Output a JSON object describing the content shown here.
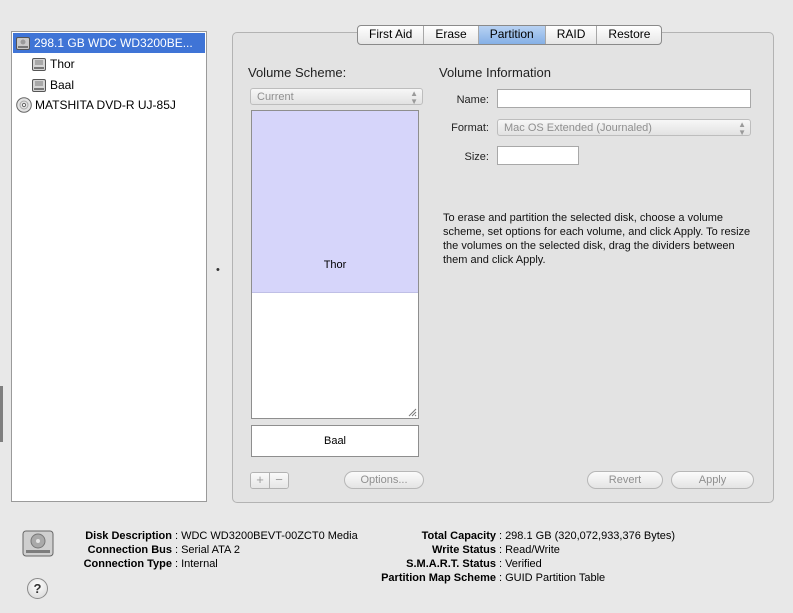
{
  "sidebar": {
    "items": [
      {
        "label": "298.1 GB WDC WD3200BE...",
        "icon": "hard-disk-icon",
        "selected": true
      },
      {
        "label": "Thor",
        "icon": "volume-icon"
      },
      {
        "label": "Baal",
        "icon": "volume-icon"
      },
      {
        "label": "MATSHITA DVD-R UJ-85J",
        "icon": "optical-disc-icon"
      }
    ]
  },
  "tabs": [
    {
      "label": "First Aid"
    },
    {
      "label": "Erase"
    },
    {
      "label": "Partition",
      "active": true
    },
    {
      "label": "RAID"
    },
    {
      "label": "Restore"
    }
  ],
  "volume_scheme": {
    "title": "Volume Scheme:",
    "selected": "Current",
    "partitions": [
      "Thor",
      "Baal"
    ]
  },
  "volume_info": {
    "title": "Volume Information",
    "name_label": "Name:",
    "name_value": "",
    "format_label": "Format:",
    "format_value": "Mac OS Extended (Journaled)",
    "size_label": "Size:",
    "size_value": ""
  },
  "help_text": "To erase and partition the selected disk, choose a volume scheme, set options for each volume, and click Apply. To resize the volumes on the selected disk, drag the dividers between them and click Apply.",
  "buttons": {
    "add": "+",
    "remove": "−",
    "options": "Options...",
    "revert": "Revert",
    "apply": "Apply",
    "help": "?"
  },
  "disk_info": {
    "left": [
      {
        "key": "Disk Description",
        "value": "WDC WD3200BEVT-00ZCT0 Media"
      },
      {
        "key": "Connection Bus",
        "value": "Serial ATA 2"
      },
      {
        "key": "Connection Type",
        "value": "Internal"
      }
    ],
    "right": [
      {
        "key": "Total Capacity",
        "value": "298.1 GB (320,072,933,376 Bytes)"
      },
      {
        "key": "Write Status",
        "value": "Read/Write"
      },
      {
        "key": "S.M.A.R.T. Status",
        "value": "Verified"
      },
      {
        "key": "Partition Map Scheme",
        "value": "GUID Partition Table"
      }
    ],
    "separator": ":"
  },
  "colors": {
    "selection": "#3f74d6",
    "partition_fill": "#d6d5fa",
    "tab_active": "#85b0e6"
  }
}
